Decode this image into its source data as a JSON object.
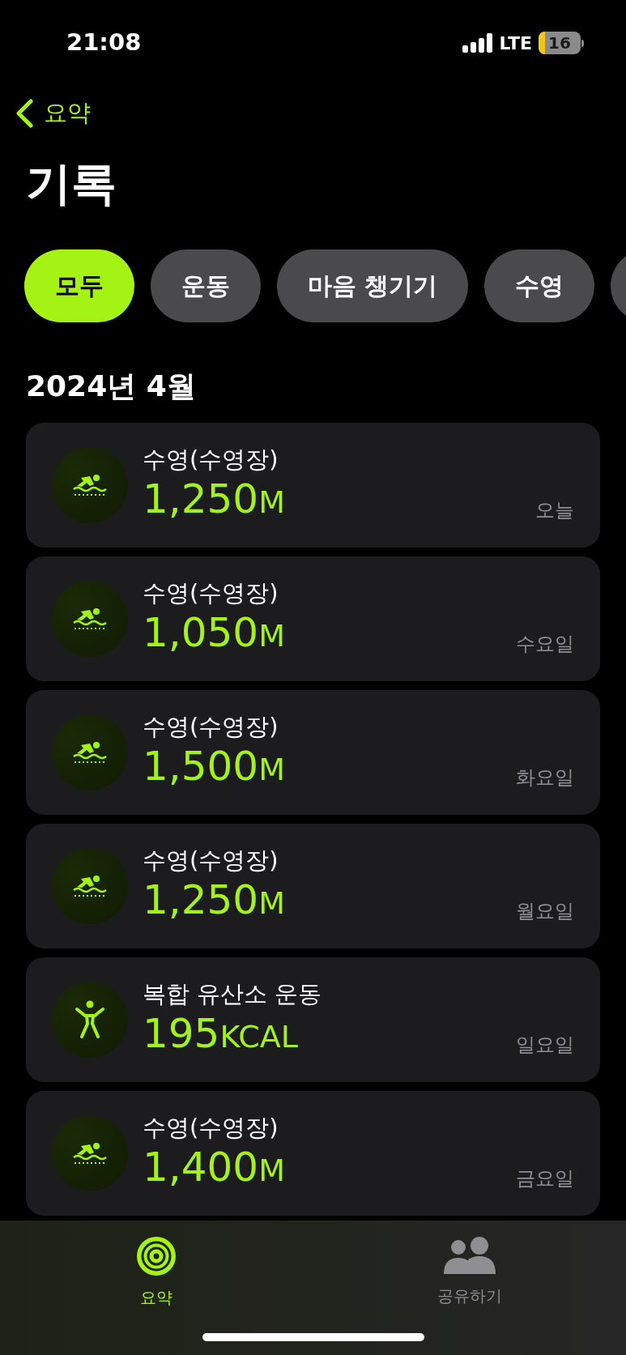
{
  "status_bar": {
    "time": "21:08",
    "network": "LTE",
    "battery": "16"
  },
  "nav": {
    "back_label": "요약",
    "title": "기록"
  },
  "filters": [
    {
      "label": "모두",
      "selected": true
    },
    {
      "label": "운동",
      "selected": false
    },
    {
      "label": "마음 챙기기",
      "selected": false
    },
    {
      "label": "수영",
      "selected": false
    }
  ],
  "section_title": "2024년 4월",
  "workouts": [
    {
      "kind": "swim",
      "name": "수영(수영장)",
      "value": "1,250",
      "unit": "M",
      "day": "오늘"
    },
    {
      "kind": "swim",
      "name": "수영(수영장)",
      "value": "1,050",
      "unit": "M",
      "day": "수요일"
    },
    {
      "kind": "swim",
      "name": "수영(수영장)",
      "value": "1,500",
      "unit": "M",
      "day": "화요일"
    },
    {
      "kind": "swim",
      "name": "수영(수영장)",
      "value": "1,250",
      "unit": "M",
      "day": "월요일"
    },
    {
      "kind": "cardio",
      "name": "복합 유산소 운동",
      "value": "195",
      "unit": "KCAL",
      "day": "일요일"
    },
    {
      "kind": "swim",
      "name": "수영(수영장)",
      "value": "1,400",
      "unit": "M",
      "day": "금요일"
    }
  ],
  "tab_bar": [
    {
      "kind": "summary",
      "label": "요약",
      "selected": true
    },
    {
      "kind": "sharing",
      "label": "공유하기",
      "selected": false
    }
  ]
}
